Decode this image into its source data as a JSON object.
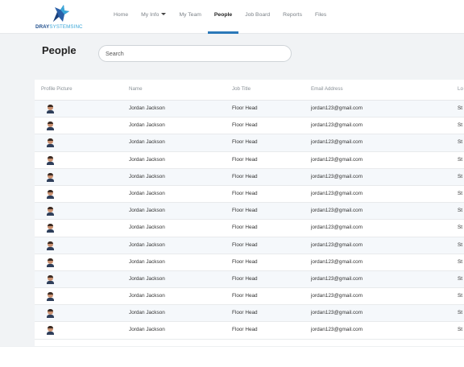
{
  "brand": {
    "name_part1": "DRAY",
    "name_part2": "SYSTEMSINC",
    "colors": {
      "primary": "#1f4e8c",
      "accent": "#3aa6d8"
    }
  },
  "nav": {
    "items": [
      {
        "label": "Home"
      },
      {
        "label": "My Info"
      },
      {
        "label": "My Team"
      },
      {
        "label": "People"
      },
      {
        "label": "Job Board"
      },
      {
        "label": "Reports"
      },
      {
        "label": "Files"
      }
    ],
    "active": "People"
  },
  "page": {
    "title": "People"
  },
  "search": {
    "placeholder": "Search"
  },
  "table": {
    "headers": [
      "Profile Picture",
      "Name",
      "Job Title",
      "Email Address",
      "Lo"
    ],
    "rows": [
      {
        "name": "Jordan Jackson",
        "job_title": "Floor Head",
        "email": "jordan123@gmail.com",
        "loc": "St"
      },
      {
        "name": "Jordan Jackson",
        "job_title": "Floor Head",
        "email": "jordan123@gmail.com",
        "loc": "St"
      },
      {
        "name": "Jordan Jackson",
        "job_title": "Floor Head",
        "email": "jordan123@gmail.com",
        "loc": "St"
      },
      {
        "name": "Jordan Jackson",
        "job_title": "Floor Head",
        "email": "jordan123@gmail.com",
        "loc": "St"
      },
      {
        "name": "Jordan Jackson",
        "job_title": "Floor Head",
        "email": "jordan123@gmail.com",
        "loc": "St"
      },
      {
        "name": "Jordan Jackson",
        "job_title": "Floor Head",
        "email": "jordan123@gmail.com",
        "loc": "St"
      },
      {
        "name": "Jordan Jackson",
        "job_title": "Floor Head",
        "email": "jordan123@gmail.com",
        "loc": "St"
      },
      {
        "name": "Jordan Jackson",
        "job_title": "Floor Head",
        "email": "jordan123@gmail.com",
        "loc": "St"
      },
      {
        "name": "Jordan Jackson",
        "job_title": "Floor Head",
        "email": "jordan123@gmail.com",
        "loc": "St"
      },
      {
        "name": "Jordan Jackson",
        "job_title": "Floor Head",
        "email": "jordan123@gmail.com",
        "loc": "St"
      },
      {
        "name": "Jordan Jackson",
        "job_title": "Floor Head",
        "email": "jordan123@gmail.com",
        "loc": "St"
      },
      {
        "name": "Jordan Jackson",
        "job_title": "Floor Head",
        "email": "jordan123@gmail.com",
        "loc": "St"
      },
      {
        "name": "Jordan Jackson",
        "job_title": "Floor Head",
        "email": "jordan123@gmail.com",
        "loc": "St"
      },
      {
        "name": "Jordan Jackson",
        "job_title": "Floor Head",
        "email": "jordan123@gmail.com",
        "loc": "St"
      }
    ]
  },
  "icons": {
    "logo": "dray-bird-logo-icon",
    "avatar": "user-avatar-icon",
    "dropdown": "caret-down-icon"
  }
}
